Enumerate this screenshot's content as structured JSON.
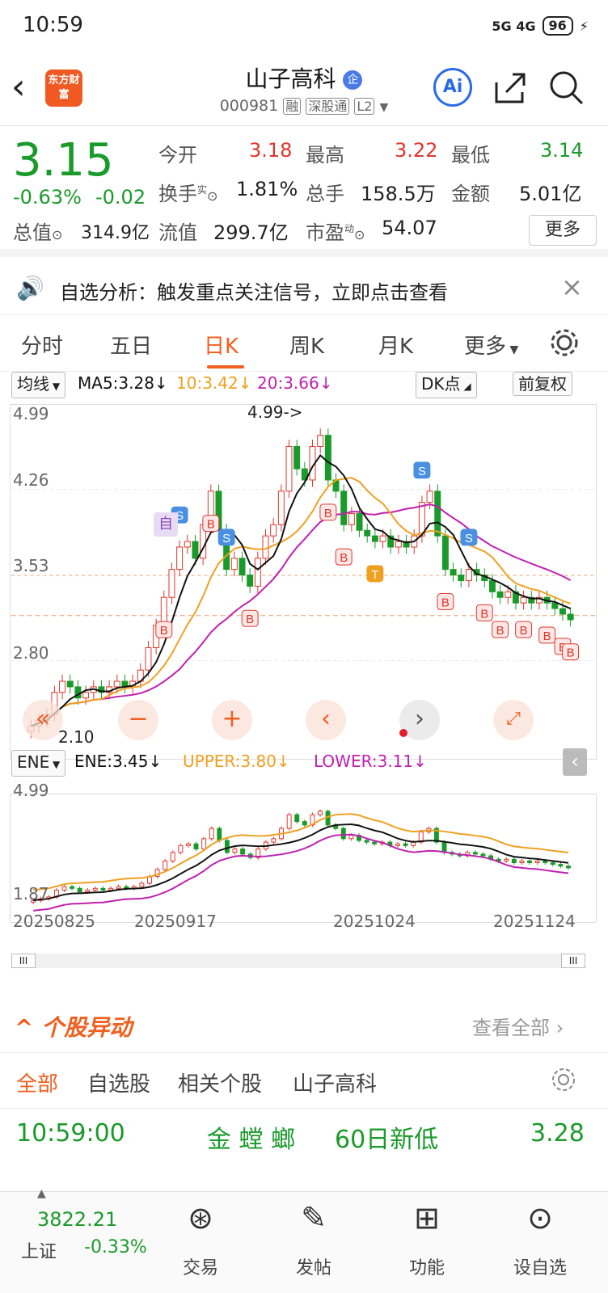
{
  "status_bar": {
    "time": "10:59",
    "network": "5G 4G",
    "battery": "96"
  },
  "header": {
    "logo_text": "东方财富",
    "stock_name": "山子高科",
    "badge": "企",
    "code": "000981",
    "tags": [
      "融",
      "深股通",
      "L2"
    ],
    "ai_label": "Ai"
  },
  "quote": {
    "price": "3.15",
    "change_pct": "-0.63%",
    "change": "-0.02",
    "open_label": "今开",
    "open": "3.18",
    "high_label": "最高",
    "high": "3.22",
    "low_label": "最低",
    "low": "3.14",
    "turnover_label": "换手",
    "turnover_sup": "实",
    "turnover": "1.81%",
    "volume_label": "总手",
    "volume": "158.5万",
    "amount_label": "金额",
    "amount": "5.01亿",
    "mktcap_label": "总值",
    "mktcap": "314.9亿",
    "float_label": "流值",
    "float": "299.7亿",
    "pe_label": "市盈",
    "pe_sup": "动",
    "pe": "54.07",
    "more": "更多"
  },
  "alert": {
    "text": "自选分析：触发重点关注信号，立即点击查看"
  },
  "tabs": [
    "分时",
    "五日",
    "日K",
    "周K",
    "月K",
    "更多"
  ],
  "active_tab": "日K",
  "chart_toolbar": {
    "indicator": "均线",
    "ma5": "MA5:3.28↓",
    "ma10": "10:3.42↓",
    "ma20": "20:3.66↓",
    "dk": "DK点",
    "adjust": "前复权"
  },
  "chart_labels": {
    "y_top": "4.99",
    "y2": "4.26",
    "y3": "3.53",
    "y4": "2.80",
    "high_note": "4.99->",
    "low_note": "2.10",
    "self_tag": "自"
  },
  "ene_toolbar": {
    "indicator": "ENE",
    "ene": "ENE:3.45↓",
    "upper": "UPPER:3.80↓",
    "lower": "LOWER:3.11↓"
  },
  "ene_labels": {
    "y_top": "4.99",
    "y_bottom": "1.87"
  },
  "x_axis": [
    "20250825",
    "20250917",
    "20251024",
    "20251124"
  ],
  "colors": {
    "up": "#e0352b",
    "down": "#1a9a2a",
    "ma5": "#111111",
    "ma10": "#f0a020",
    "ma20": "#c020b0",
    "accent": "#f06020"
  },
  "section": {
    "title": "个股异动",
    "view_all": "查看全部"
  },
  "sub_tabs": [
    "全部",
    "自选股",
    "相关个股",
    "山子高科"
  ],
  "event": {
    "time": "10:59:00",
    "type": "金 螳 螂",
    "desc": "60日新低",
    "value": "3.28"
  },
  "bottom_nav": {
    "index_value": "3822.21",
    "index_name": "上证",
    "index_change": "-0.33%",
    "items": [
      "交易",
      "发帖",
      "功能",
      "设自选"
    ]
  }
}
